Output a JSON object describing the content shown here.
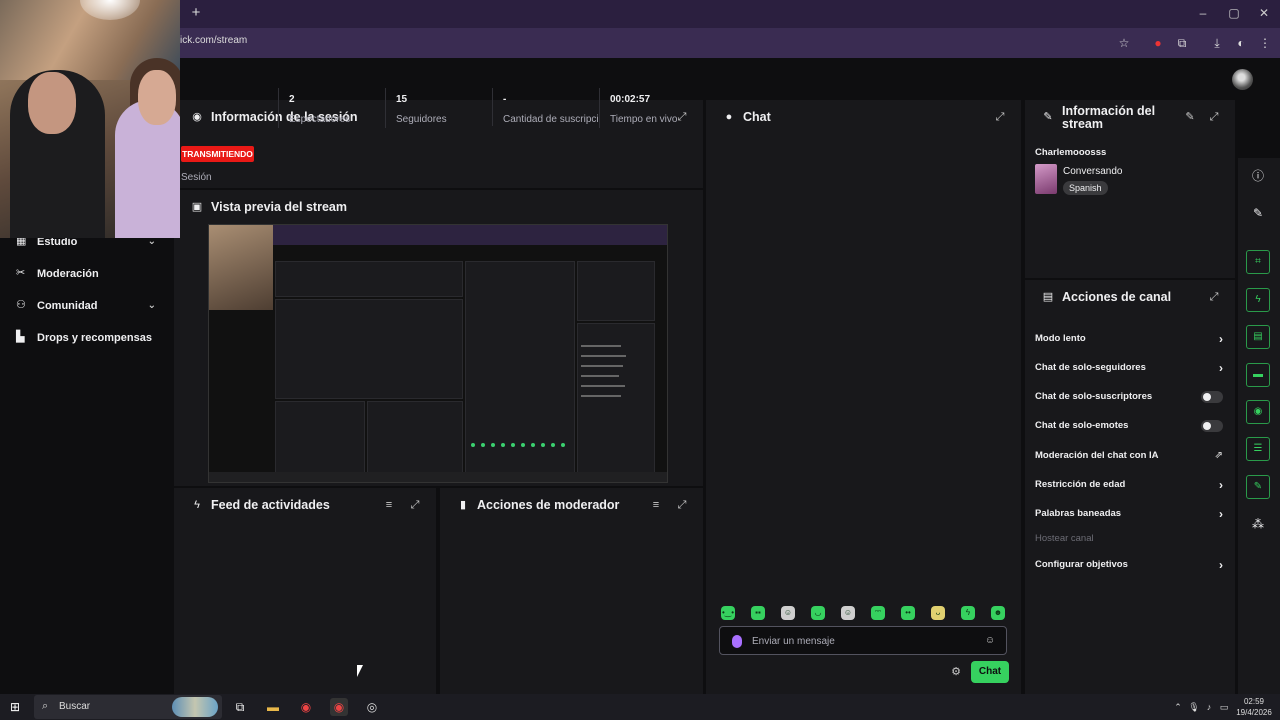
{
  "browser": {
    "url": "ick.com/stream",
    "new_tab_icon": "+",
    "window_controls": {
      "minimize": "–",
      "maximize": "▢",
      "close": "✕"
    }
  },
  "sidebar": {
    "items": [
      {
        "label": "Estudio",
        "icon": "studio-icon",
        "expandable": true
      },
      {
        "label": "Moderación",
        "icon": "moderation-icon",
        "expandable": false
      },
      {
        "label": "Comunidad",
        "icon": "community-icon",
        "expandable": true
      },
      {
        "label": "Drops y recompensas",
        "icon": "drops-icon",
        "expandable": false
      }
    ]
  },
  "session_panel": {
    "title": "Información de la sesión",
    "live_badge": "TRANSMITIENDO",
    "session_label": "Sesión",
    "stats": [
      {
        "value": "2",
        "label": "Espectadores"
      },
      {
        "value": "15",
        "label": "Seguidores"
      },
      {
        "value": "-",
        "label": "Cantidad de suscripciones"
      },
      {
        "value": "00:02:57",
        "label": "Tiempo en vivo"
      }
    ]
  },
  "preview_panel": {
    "title": "Vista previa del stream"
  },
  "activity_panel": {
    "title": "Feed de actividades"
  },
  "mod_actions_panel": {
    "title": "Acciones de moderador"
  },
  "chat_panel": {
    "title": "Chat",
    "input_placeholder": "Enviar un mensaje",
    "send_label": "Chat",
    "emote_count": 10
  },
  "stream_info_panel": {
    "title_line1": "Información del",
    "title_line2": "stream",
    "channel": "Charlemooosss",
    "category": "Conversando",
    "language": "Spanish"
  },
  "channel_actions_panel": {
    "title": "Acciones de canal",
    "rows": [
      {
        "label": "Modo lento",
        "control": "arrow"
      },
      {
        "label": "Chat de solo-seguidores",
        "control": "arrow"
      },
      {
        "label": "Chat de solo-suscriptores",
        "control": "toggle",
        "on": false
      },
      {
        "label": "Chat de solo-emotes",
        "control": "toggle",
        "on": false
      },
      {
        "label": "Moderación del chat con IA",
        "control": "external"
      },
      {
        "label": "Restricción de edad",
        "control": "arrow"
      },
      {
        "label": "Palabras baneadas",
        "control": "arrow"
      },
      {
        "label": "Hostear canal",
        "control": "none",
        "disabled": true
      },
      {
        "label": "Configurar objetivos",
        "control": "arrow"
      }
    ]
  },
  "taskbar": {
    "search_text": "Buscar",
    "time": "02:59",
    "date": "19/4/2026"
  },
  "colors": {
    "accent_green": "#36d15f",
    "live_red": "#e91916",
    "panel_bg": "#18181b",
    "page_bg": "#0e0e10"
  }
}
